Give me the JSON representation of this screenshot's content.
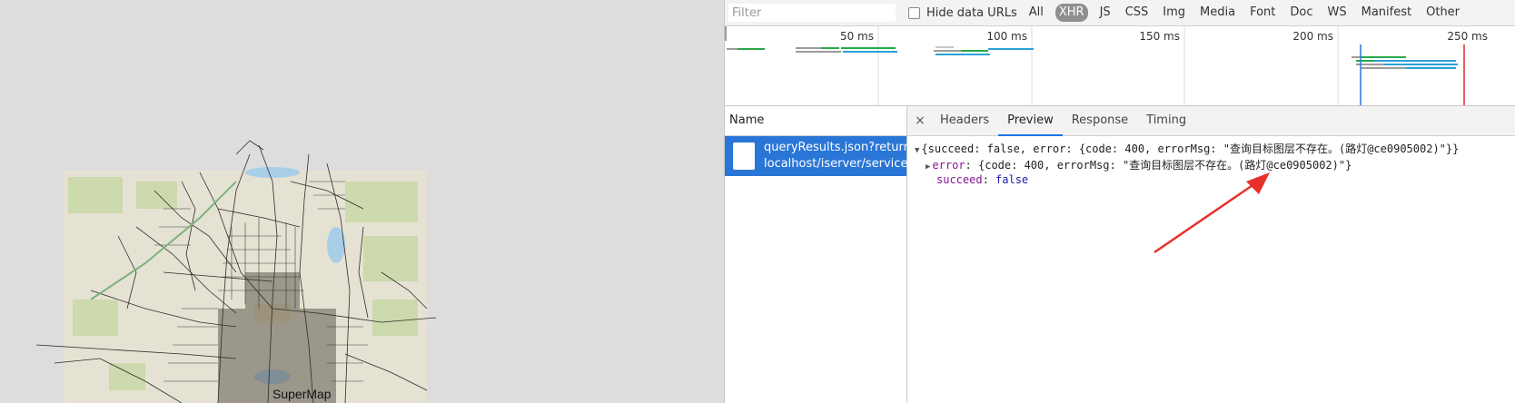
{
  "map": {
    "label": "SuperMap"
  },
  "devtools": {
    "filter": {
      "placeholder": "Filter",
      "value": ""
    },
    "hide_data_urls": "Hide data URLs",
    "types": [
      "All",
      "XHR",
      "JS",
      "CSS",
      "Img",
      "Media",
      "Font",
      "Doc",
      "WS",
      "Manifest",
      "Other"
    ],
    "active_type": "XHR",
    "timeline_labels": [
      "50 ms",
      "100 ms",
      "150 ms",
      "200 ms",
      "250 ms"
    ],
    "name_header": "Name",
    "request": {
      "name": "queryResults.json?return...",
      "path": "localhost/iserver/service..."
    },
    "detail_tabs": [
      "Headers",
      "Preview",
      "Response",
      "Timing"
    ],
    "active_tab": "Preview",
    "close_symbol": "×",
    "preview": {
      "line1": "{succeed: false, error: {code: 400, errorMsg: \"查询目标图层不存在。(路灯@ce0905002)\"}}",
      "error_key": "error",
      "error_value": "{code: 400, errorMsg: \"查询目标图层不存在。(路灯@ce0905002)\"}",
      "succeed_key": "succeed",
      "succeed_value": "false"
    },
    "colors": {
      "selected_row": "#2a76d6",
      "annotation_arrow": "#e8302a",
      "tab_underline": "#1a73e8"
    }
  }
}
